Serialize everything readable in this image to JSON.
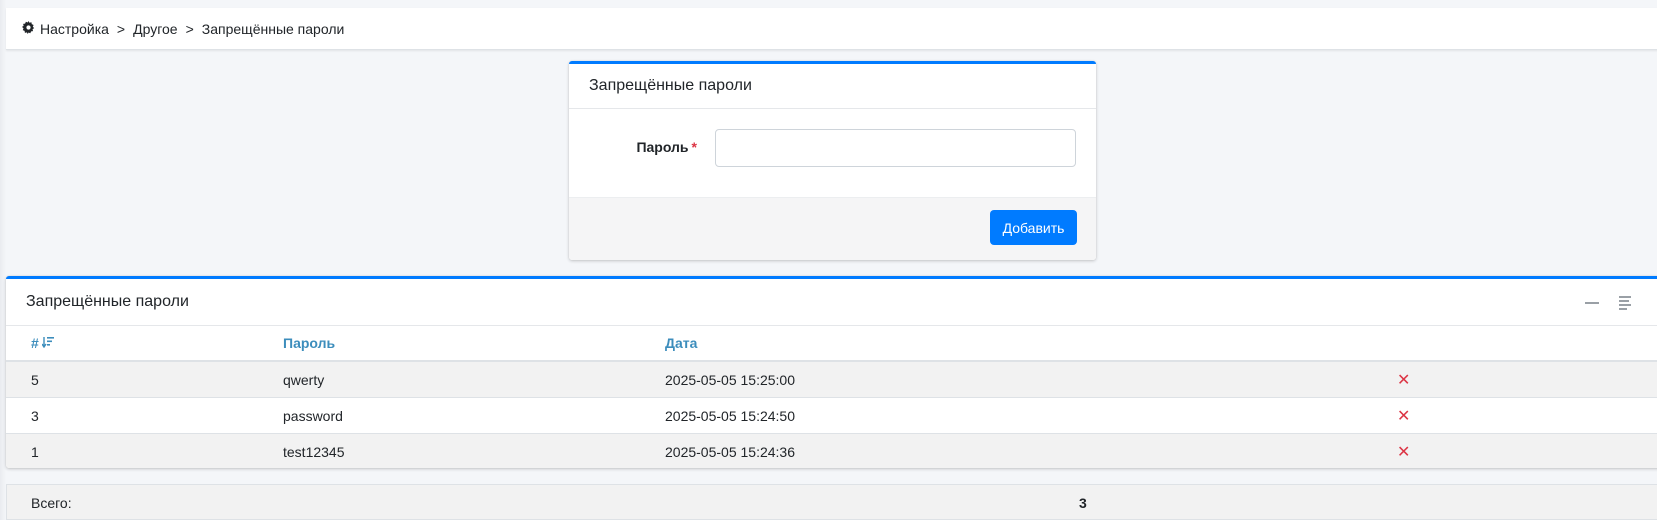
{
  "breadcrumb": {
    "icon": "gear-icon",
    "items": [
      "Настройка",
      "Другое",
      "Запрещённые пароли"
    ],
    "separator": ">"
  },
  "form": {
    "title": "Запрещённые пароли",
    "password_label": "Пароль",
    "required_mark": "*",
    "password_value": "",
    "add_button": "Добавить"
  },
  "list": {
    "title": "Запрещённые пароли",
    "columns": [
      "#",
      "Пароль",
      "Дата"
    ],
    "rows": [
      {
        "id": "5",
        "password": "qwerty",
        "date": "2025-05-05 15:25:00"
      },
      {
        "id": "3",
        "password": "password",
        "date": "2025-05-05 15:24:50"
      },
      {
        "id": "1",
        "password": "test12345",
        "date": "2025-05-05 15:24:36"
      }
    ],
    "delete_glyph": "✕"
  },
  "total": {
    "label": "Всего:",
    "value": "3"
  },
  "colors": {
    "accent": "#007bff",
    "link": "#3c8dbc",
    "danger": "#dc3545"
  }
}
